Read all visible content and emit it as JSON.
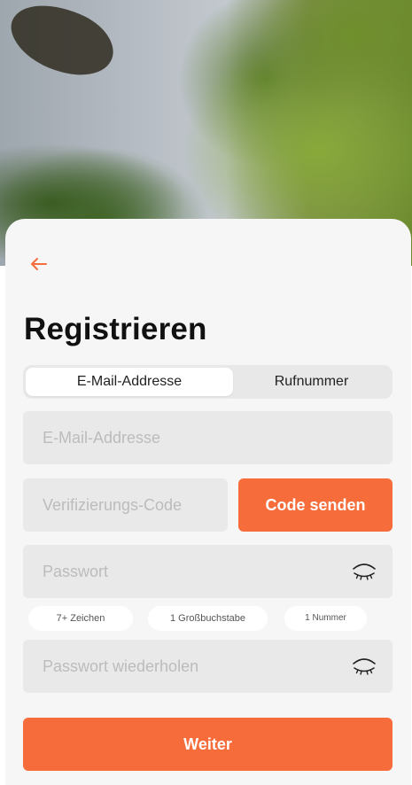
{
  "header": {
    "title": "Registrieren",
    "back_icon": "arrow-left-icon"
  },
  "tabs": {
    "email_label": "E-Mail-Addresse",
    "phone_label": "Rufnummer",
    "selected": "email"
  },
  "form": {
    "email_placeholder": "E-Mail-Addresse",
    "code_placeholder": "Verifizierungs-Code",
    "send_code_label": "Code senden",
    "password_placeholder": "Passwort",
    "password_repeat_placeholder": "Passwort wiederholen",
    "eye_icon": "eye-closed-icon"
  },
  "requirements": [
    {
      "label": "7+ Zeichen"
    },
    {
      "label": "1 Großbuchstabe"
    },
    {
      "label": "1 Nummer"
    }
  ],
  "submit_label": "Weiter",
  "colors": {
    "accent": "#f66c3a",
    "sheet_bg": "#f6f6f6",
    "field_bg": "#e9e9e9",
    "placeholder": "#bcbcbc"
  }
}
